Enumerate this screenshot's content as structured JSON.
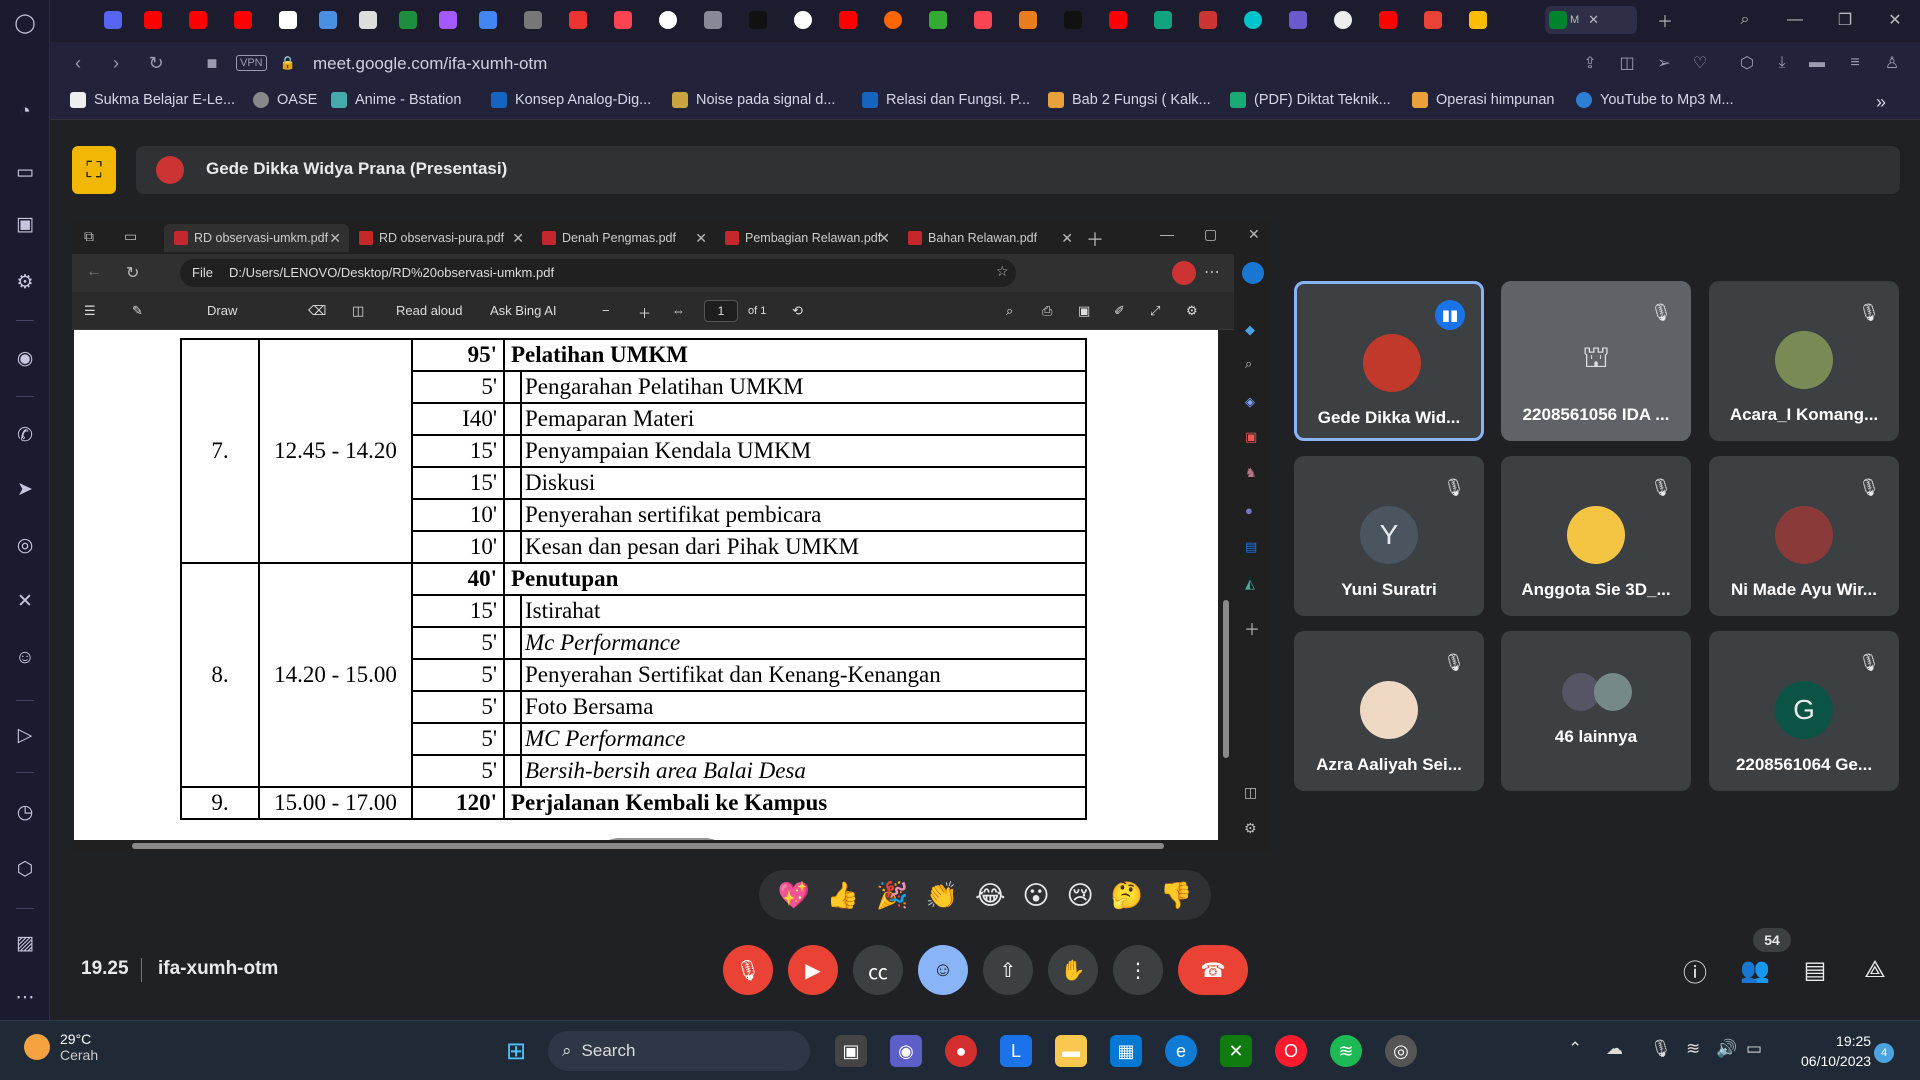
{
  "browser": {
    "url": "meet.google.com/ifa-xumh-otm",
    "vpn_label": "VPN",
    "active_tab_label": "M",
    "bookmarks": [
      "Sukma Belajar E-Le...",
      "OASE",
      "Anime - Bstation",
      "Konsep Analog-Dig...",
      "Noise pada signal d...",
      "Relasi dan Fungsi. P...",
      "Bab 2 Fungsi ( Kalk...",
      "(PDF) Diktat Teknik...",
      "Operasi himpunan",
      "YouTube to Mp3 M..."
    ]
  },
  "meet": {
    "presenter_title": "Gede Dikka Widya Prana (Presentasi)",
    "time": "19.25",
    "code": "ifa-xumh-otm",
    "participant_count": "54",
    "participants": [
      {
        "name": "Gede Dikka Wid...",
        "initial": "",
        "speaking": true
      },
      {
        "name": "2208561056 IDA ...",
        "initial": "",
        "speaking": false
      },
      {
        "name": "Acara_I Komang...",
        "initial": "",
        "speaking": false
      },
      {
        "name": "Yuni Suratri",
        "initial": "Y",
        "speaking": false
      },
      {
        "name": "Anggota Sie 3D_...",
        "initial": "",
        "speaking": false
      },
      {
        "name": "Ni Made Ayu Wir...",
        "initial": "",
        "speaking": false
      },
      {
        "name": "Azra Aaliyah Sei...",
        "initial": "",
        "speaking": false
      },
      {
        "name": "46 lainnya",
        "initial": "",
        "speaking": false
      },
      {
        "name": "2208561064 Ge...",
        "initial": "G",
        "speaking": false
      }
    ],
    "reactions": [
      "💖",
      "👍",
      "🎉",
      "👏",
      "😂",
      "😮",
      "😢",
      "🤔",
      "👎"
    ]
  },
  "edge": {
    "tabs": [
      "RD observasi-umkm.pdf",
      "RD observasi-pura.pdf",
      "Denah Pengmas.pdf",
      "Pembagian Relawan.pdf",
      "Bahan Relawan.pdf"
    ],
    "file_label": "File",
    "path": "D:/Users/LENOVO/Desktop/RD%20observasi-umkm.pdf",
    "toolbar": {
      "draw": "Draw",
      "read_aloud": "Read aloud",
      "ask_bing": "Ask Bing AI",
      "page": "1",
      "of_pages": "of 1"
    }
  },
  "schedule": {
    "rows": [
      {
        "no": "7.",
        "time": "12.45 - 14.20",
        "dur": "95'",
        "act": "Pelatihan UMKM",
        "style": "bold",
        "group_start": true,
        "group_len": 7
      },
      {
        "dur": "5'",
        "act": "Pengarahan Pelatihan UMKM",
        "style": "sub"
      },
      {
        "dur": "I40'",
        "act": "Pemaparan Materi",
        "style": "sub"
      },
      {
        "dur": "15'",
        "act": "Penyampaian Kendala UMKM",
        "style": "sub"
      },
      {
        "dur": "15'",
        "act": "Diskusi",
        "style": "sub"
      },
      {
        "dur": "10'",
        "act": "Penyerahan sertifikat pembicara",
        "style": "sub"
      },
      {
        "dur": "10'",
        "act": "Kesan dan pesan dari Pihak UMKM",
        "style": "sub"
      },
      {
        "no": "8.",
        "time": "14.20 - 15.00",
        "dur": "40'",
        "act": "Penutupan",
        "style": "bold",
        "group_start": true,
        "group_len": 7
      },
      {
        "dur": "15'",
        "act": "Istirahat",
        "style": "sub"
      },
      {
        "dur": "5'",
        "act": "Mc Performance",
        "style": "sub-ital"
      },
      {
        "dur": "5'",
        "act": "Penyerahan Sertifikat dan Kenang-Kenangan",
        "style": "sub"
      },
      {
        "dur": "5'",
        "act": "Foto Bersama",
        "style": "sub"
      },
      {
        "dur": "5'",
        "act": "MC Performance",
        "style": "sub-ital"
      },
      {
        "dur": "5'",
        "act": "Bersih-bersih area Balai Desa",
        "style": "sub-ital"
      },
      {
        "no": "9.",
        "time": "15.00 - 17.00",
        "dur": "120'",
        "act": "Perjalanan Kembali ke Kampus",
        "style": "bold",
        "group_start": true,
        "group_len": 1
      }
    ]
  },
  "taskbar": {
    "temperature": "29°C",
    "condition": "Cerah",
    "search_placeholder": "Search",
    "clock_time": "19:25",
    "clock_date": "06/10/2023",
    "notifications": "4"
  }
}
